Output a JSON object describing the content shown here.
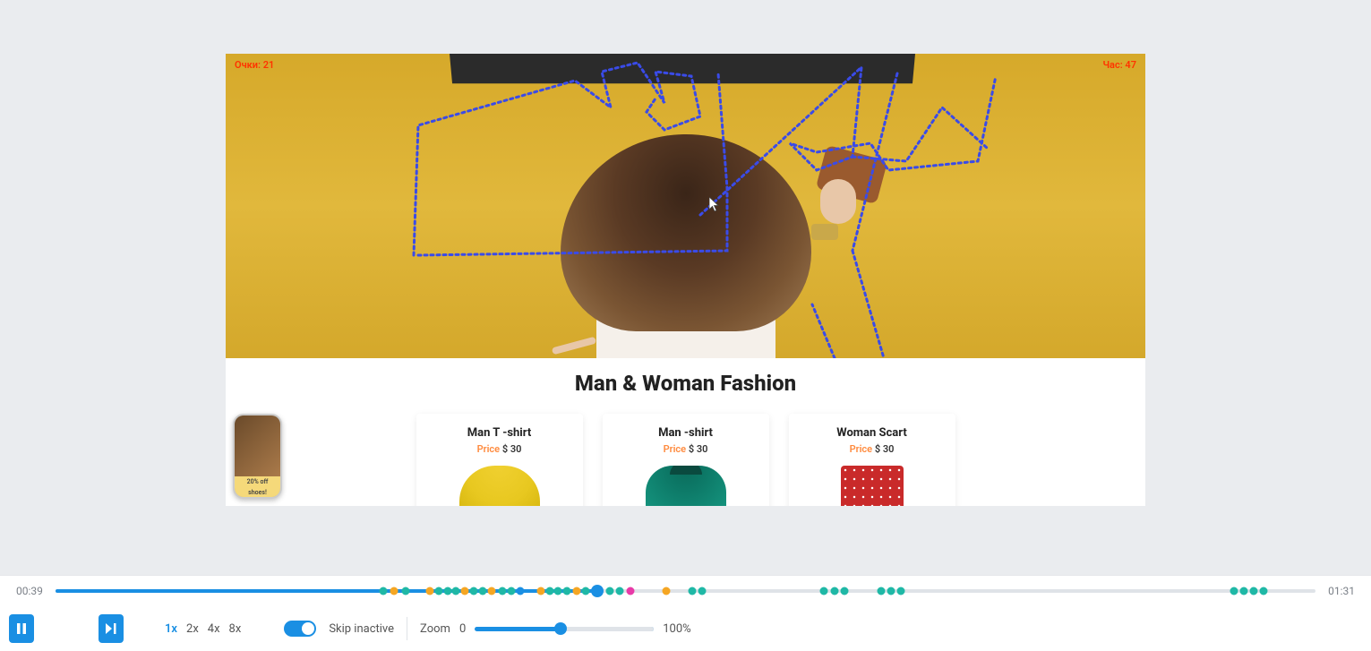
{
  "overlay": {
    "score_label": "Очки: 21",
    "time_label": "Час: 47"
  },
  "section_title": "Man & Woman Fashion",
  "products": [
    {
      "title": "Man T -shirt",
      "price_label": "Price",
      "price_value": "$ 30"
    },
    {
      "title": "Man -shirt",
      "price_label": "Price",
      "price_value": "$ 30"
    },
    {
      "title": "Woman Scart",
      "price_label": "Price",
      "price_value": "$ 30"
    }
  ],
  "mini_preview": {
    "badge": "20% off",
    "badge_sub": "shoes!"
  },
  "player": {
    "current_time": "00:39",
    "total_time": "01:31",
    "progress_pct": 43,
    "speeds": [
      "1x",
      "2x",
      "4x",
      "8x"
    ],
    "active_speed": "1x",
    "skip_inactive_label": "Skip inactive",
    "zoom_label": "Zoom",
    "zoom_min": "0",
    "zoom_max": "100%",
    "zoom_pct": 48,
    "timeline_events": [
      {
        "pos": 26.0,
        "color": "teal"
      },
      {
        "pos": 26.9,
        "color": "orange"
      },
      {
        "pos": 27.8,
        "color": "teal"
      },
      {
        "pos": 29.7,
        "color": "orange"
      },
      {
        "pos": 30.4,
        "color": "teal"
      },
      {
        "pos": 31.1,
        "color": "teal"
      },
      {
        "pos": 31.8,
        "color": "teal"
      },
      {
        "pos": 32.5,
        "color": "orange"
      },
      {
        "pos": 33.2,
        "color": "teal"
      },
      {
        "pos": 33.9,
        "color": "teal"
      },
      {
        "pos": 34.6,
        "color": "orange"
      },
      {
        "pos": 35.5,
        "color": "teal"
      },
      {
        "pos": 36.2,
        "color": "teal"
      },
      {
        "pos": 36.9,
        "color": "blue"
      },
      {
        "pos": 38.5,
        "color": "orange"
      },
      {
        "pos": 39.2,
        "color": "teal"
      },
      {
        "pos": 39.9,
        "color": "teal"
      },
      {
        "pos": 40.6,
        "color": "teal"
      },
      {
        "pos": 41.4,
        "color": "orange"
      },
      {
        "pos": 42.1,
        "color": "teal"
      },
      {
        "pos": 44.0,
        "color": "teal"
      },
      {
        "pos": 44.8,
        "color": "teal"
      },
      {
        "pos": 45.6,
        "color": "magenta"
      },
      {
        "pos": 48.5,
        "color": "orange"
      },
      {
        "pos": 50.5,
        "color": "teal"
      },
      {
        "pos": 51.3,
        "color": "teal"
      },
      {
        "pos": 61.0,
        "color": "teal"
      },
      {
        "pos": 61.8,
        "color": "teal"
      },
      {
        "pos": 62.6,
        "color": "teal"
      },
      {
        "pos": 65.5,
        "color": "teal"
      },
      {
        "pos": 66.3,
        "color": "teal"
      },
      {
        "pos": 67.1,
        "color": "teal"
      },
      {
        "pos": 93.5,
        "color": "teal"
      },
      {
        "pos": 94.3,
        "color": "teal"
      },
      {
        "pos": 95.1,
        "color": "teal"
      },
      {
        "pos": 95.9,
        "color": "teal"
      }
    ]
  }
}
